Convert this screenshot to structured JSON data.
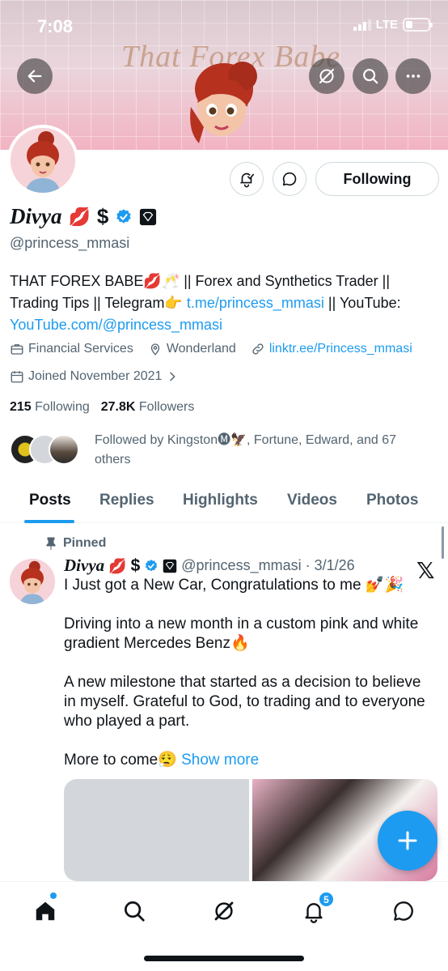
{
  "status_bar": {
    "time": "7:08",
    "network": "LTE"
  },
  "banner": {
    "title": "That Forex Babe"
  },
  "profile": {
    "display_name": "Divya",
    "name_emoji": "💋",
    "name_symbol": "$",
    "handle": "@princess_mmasi",
    "following_button": "Following",
    "bio": {
      "part1": "THAT FOREX BABE💋🥂 || Forex and Synthetics Trader || Trading Tips || Telegram👉",
      "link1": "t.me/princess_mmasi",
      "part2": " || YouTube: ",
      "link2": "YouTube.com/@princess_mmasi"
    },
    "category": "Financial Services",
    "location": "Wonderland",
    "website": "linktr.ee/Princess_mmasi",
    "joined": "Joined November 2021",
    "following_count": "215",
    "following_label": "Following",
    "followers_count": "27.8K",
    "followers_label": "Followers",
    "followed_by": "Followed by Kingston🅜🦅, Fortune, Edward, and 67 others"
  },
  "tabs": [
    {
      "label": "Posts"
    },
    {
      "label": "Replies"
    },
    {
      "label": "Highlights"
    },
    {
      "label": "Videos"
    },
    {
      "label": "Photos"
    }
  ],
  "post": {
    "pinned_label": "Pinned",
    "author_name": "Divya",
    "author_emoji": "💋",
    "author_symbol": "$",
    "handle_date": "@princess_mmasi · 3/1/26",
    "paragraph1": "I Just got a New Car, Congratulations to me 💅🎉",
    "paragraph2": "Driving into a new month in a custom pink and white gradient Mercedes Benz🔥",
    "paragraph3": "A new milestone that started as a decision to believe in myself. Grateful to God, to trading and to everyone who played a part.",
    "paragraph4": "More to come😮‍💨",
    "show_more": "Show more",
    "x_label": "𝕏"
  },
  "bottom_nav": {
    "notifications_badge": "5"
  },
  "colors": {
    "accent": "#1d9bf0",
    "text": "#0f1419",
    "secondary": "#536471"
  }
}
